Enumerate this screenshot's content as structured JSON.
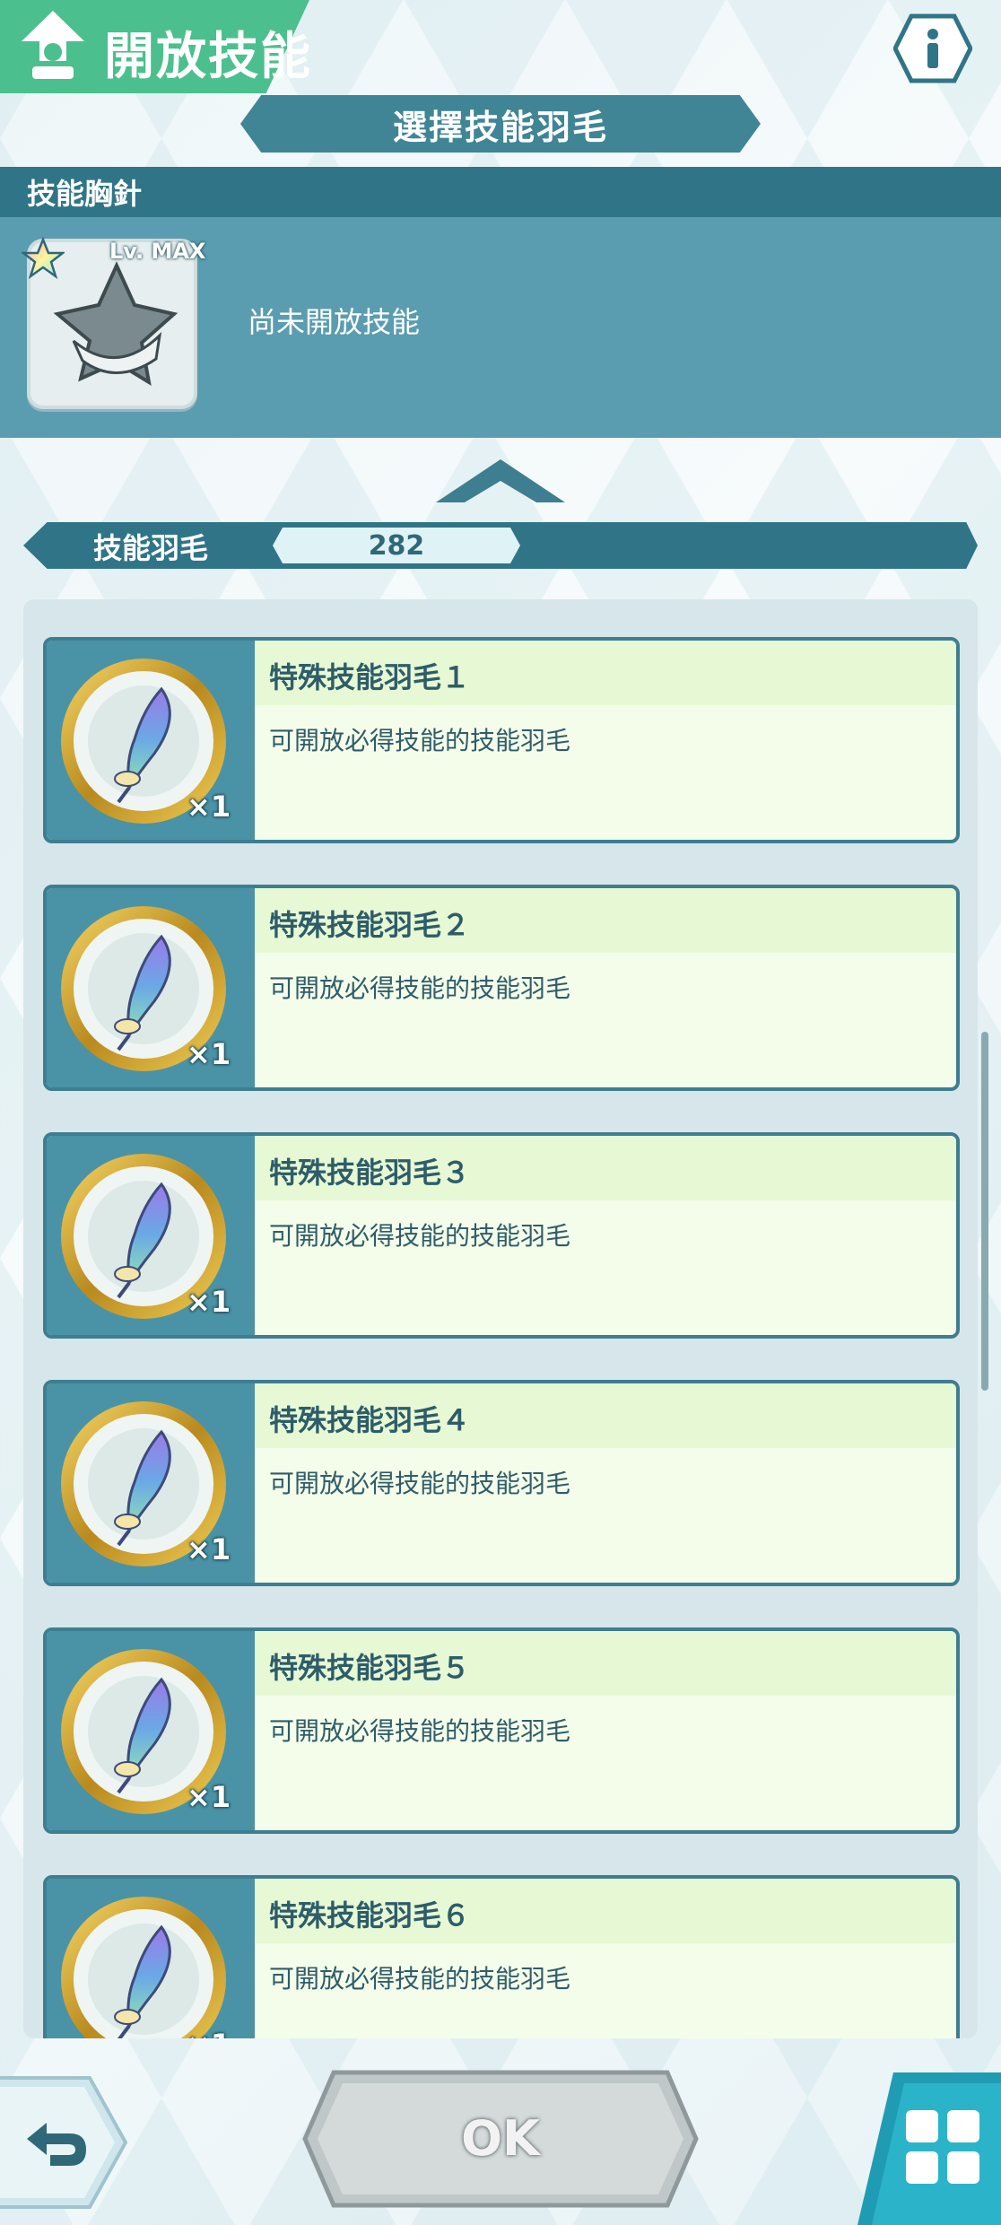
{
  "header": {
    "title": "開放技能",
    "banner": "選擇技能羽毛"
  },
  "brooch": {
    "section_label": "技能胸針",
    "level": "Lv. MAX",
    "status": "尚未開放技能"
  },
  "feathers": {
    "label": "技能羽毛",
    "count": "282"
  },
  "items": [
    {
      "name": "特殊技能羽毛１",
      "desc": "可開放必得技能的技能羽毛",
      "qty": "×1"
    },
    {
      "name": "特殊技能羽毛２",
      "desc": "可開放必得技能的技能羽毛",
      "qty": "×1"
    },
    {
      "name": "特殊技能羽毛３",
      "desc": "可開放必得技能的技能羽毛",
      "qty": "×1"
    },
    {
      "name": "特殊技能羽毛４",
      "desc": "可開放必得技能的技能羽毛",
      "qty": "×1"
    },
    {
      "name": "特殊技能羽毛５",
      "desc": "可開放必得技能的技能羽毛",
      "qty": "×1"
    },
    {
      "name": "特殊技能羽毛６",
      "desc": "可開放必得技能的技能羽毛",
      "qty": "×1"
    }
  ],
  "footer": {
    "ok_label": "OK"
  },
  "colors": {
    "accent_green": "#4cbf8e",
    "teal_dark": "#2f7587",
    "teal_panel": "#5a9db0"
  }
}
